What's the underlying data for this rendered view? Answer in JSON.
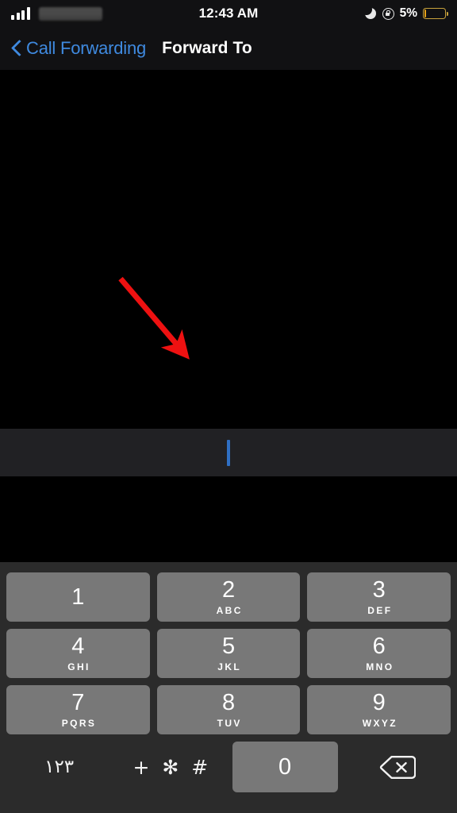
{
  "status_bar": {
    "signal_icon": "signal-bars-icon",
    "signal_bars_filled": 4,
    "carrier_redacted": true,
    "time": "12:43 AM",
    "dnd_icon": "moon-icon",
    "rotation_lock_icon": "rotation-lock-icon",
    "battery_percent": "5%",
    "battery_level": 5,
    "battery_color": "#e8a317"
  },
  "nav_bar": {
    "back_icon": "chevron-left-icon",
    "back_label": "Call Forwarding",
    "title": "Forward To",
    "tint_color": "#3f8ae0"
  },
  "annotation": {
    "arrow_icon": "red-arrow-icon",
    "arrow_color": "#ee1111",
    "points_to": "phone-number-input-field"
  },
  "input_field": {
    "value": "",
    "placeholder": "",
    "caret_visible": true,
    "caret_color": "#2f6fc4",
    "background": "#212124"
  },
  "keypad": {
    "background": "#2b2b2b",
    "key_color": "#787878",
    "rows": [
      [
        {
          "num": "1",
          "letters": ""
        },
        {
          "num": "2",
          "letters": "ABC"
        },
        {
          "num": "3",
          "letters": "DEF"
        }
      ],
      [
        {
          "num": "4",
          "letters": "GHI"
        },
        {
          "num": "5",
          "letters": "JKL"
        },
        {
          "num": "6",
          "letters": "MNO"
        }
      ],
      [
        {
          "num": "7",
          "letters": "PQRS"
        },
        {
          "num": "8",
          "letters": "TUV"
        },
        {
          "num": "9",
          "letters": "WXYZ"
        }
      ]
    ],
    "bottom_row": {
      "alt_digits_label": "١٢٣",
      "symbols_label": "+ ✻ #",
      "zero_label": "0",
      "backspace_icon": "backspace-delete-icon"
    }
  }
}
